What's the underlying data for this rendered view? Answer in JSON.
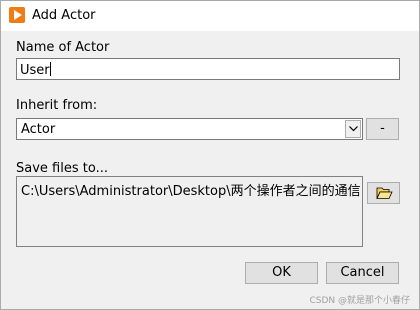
{
  "window": {
    "title": "Add Actor",
    "icon": "labview-play-icon",
    "accent_color": "#f07c16"
  },
  "name_field": {
    "label": "Name of Actor",
    "value": "User"
  },
  "inherit": {
    "label": "Inherit from:",
    "selected": "Actor",
    "side_button_label": "-"
  },
  "save": {
    "label": "Save files to...",
    "path": "C:\\Users\\Administrator\\Desktop\\两个操作者之间的通信",
    "browse_icon": "folder-open-icon"
  },
  "buttons": {
    "ok": "OK",
    "cancel": "Cancel"
  },
  "watermark": "CSDN @就是那个小春仔"
}
